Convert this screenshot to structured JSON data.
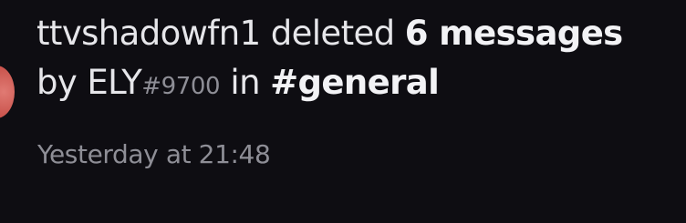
{
  "log": {
    "username": "ttvshadowfn1",
    "action_text": "deleted",
    "count_text": "6 messages",
    "by_text": "by",
    "target_name": "ELY",
    "target_tag": "#9700",
    "in_text": "in",
    "channel": "#general"
  },
  "timestamp": "Yesterday at 21:48",
  "avatar": {
    "color": "#c9524b"
  }
}
